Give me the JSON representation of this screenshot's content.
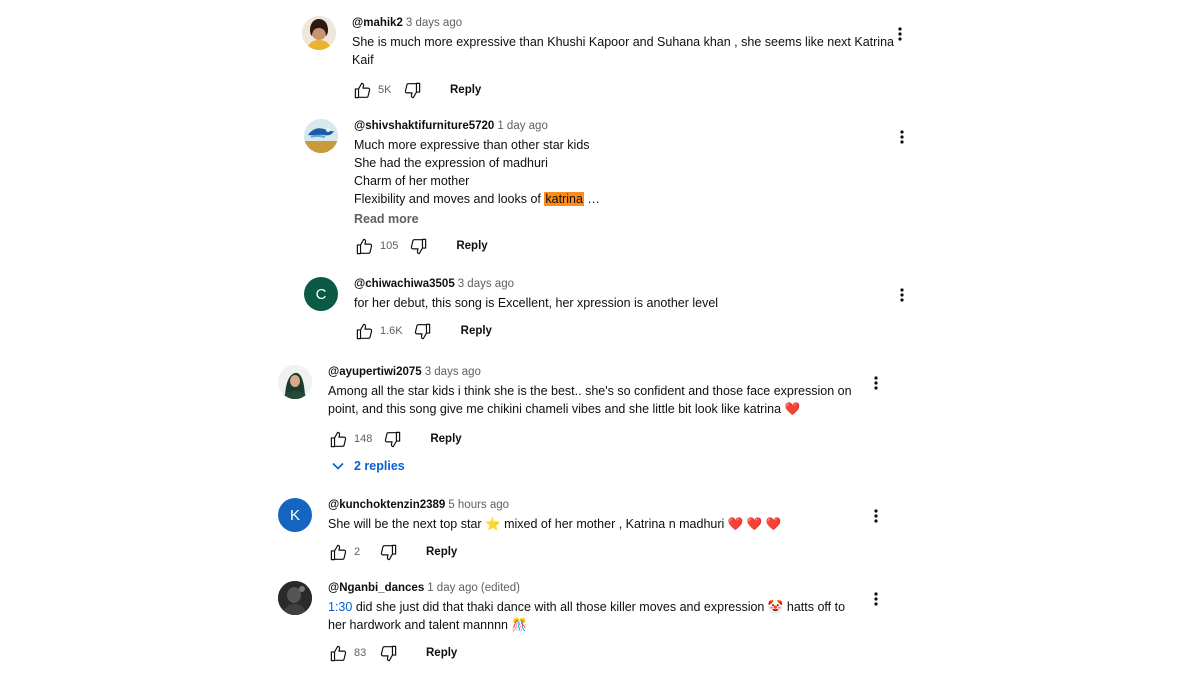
{
  "comments": [
    {
      "author": "@mahik2",
      "time": "3 days ago",
      "lines": [
        "She is much more expressive than Khushi Kapoor and Suhana khan , she seems like next Katrina",
        "Kaif"
      ],
      "likes": "5K",
      "reply_label": "Reply"
    },
    {
      "author": "@shivshaktifurniture5720",
      "time": "1 day ago",
      "lines": [
        "Much more expressive than other star kids",
        "She had the expression of madhuri",
        "Charm of her mother"
      ],
      "last_line_prefix": "Flexibility and moves and looks of ",
      "highlight": "katrina",
      "ellipsis": " …",
      "read_more": "Read more",
      "likes": "105",
      "reply_label": "Reply"
    },
    {
      "author": "@chiwachiwa3505",
      "time": "3 days ago",
      "avatar_letter": "C",
      "lines": [
        "for her debut, this song is Excellent, her xpression is another level"
      ],
      "likes": "1.6K",
      "reply_label": "Reply"
    },
    {
      "author": "@ayupertiwi2075",
      "time": "3 days ago",
      "lines": [
        "Among all the star kids i think she is the best.. she's so confident and those face expression on",
        "point, and this song give me chikini chameli vibes and she little bit look like katrina ❤️"
      ],
      "likes": "148",
      "reply_label": "Reply",
      "replies_label": "2 replies"
    },
    {
      "author": "@kunchoktenzin2389",
      "time": "5 hours ago",
      "avatar_letter": "K",
      "lines": [
        "She will be the next top star ⭐  mixed of her mother , Katrina n madhuri ❤️ ❤️ ❤️"
      ],
      "likes": "2",
      "reply_label": "Reply"
    },
    {
      "author": "@Nganbi_dances",
      "time": "1 day ago (edited)",
      "timestamp_link": "1:30",
      "first_line_rest": " did she just did that thaki dance with all those killer moves and expression 🤡 hatts off to",
      "lines": [
        "her hardwork and talent mannnn 🎊"
      ],
      "likes": "83",
      "reply_label": "Reply"
    }
  ],
  "icons": {
    "like": "thumbs-up-icon",
    "dislike": "thumbs-down-icon",
    "menu": "more-vert-icon",
    "expand": "chevron-down-icon"
  },
  "colors": {
    "text": "#0f0f0f",
    "secondary": "#606060",
    "link": "#065fd4",
    "highlight": "#ff8c1a",
    "avatar_c": "#0b5a45",
    "avatar_k": "#1565c0"
  }
}
